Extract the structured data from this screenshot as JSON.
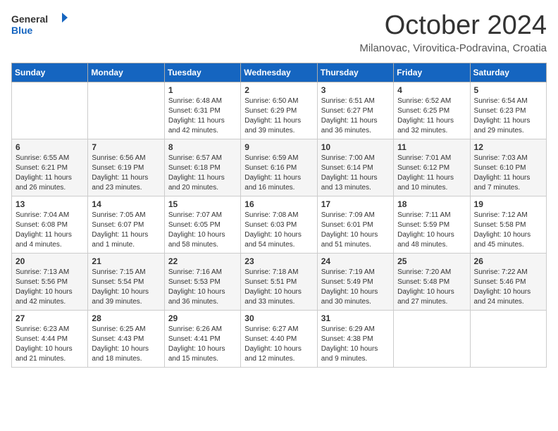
{
  "header": {
    "logo_general": "General",
    "logo_blue": "Blue",
    "month_title": "October 2024",
    "subtitle": "Milanovac, Virovitica-Podravina, Croatia"
  },
  "weekdays": [
    "Sunday",
    "Monday",
    "Tuesday",
    "Wednesday",
    "Thursday",
    "Friday",
    "Saturday"
  ],
  "weeks": [
    [
      {
        "day": "",
        "info": ""
      },
      {
        "day": "",
        "info": ""
      },
      {
        "day": "1",
        "info": "Sunrise: 6:48 AM\nSunset: 6:31 PM\nDaylight: 11 hours and 42 minutes."
      },
      {
        "day": "2",
        "info": "Sunrise: 6:50 AM\nSunset: 6:29 PM\nDaylight: 11 hours and 39 minutes."
      },
      {
        "day": "3",
        "info": "Sunrise: 6:51 AM\nSunset: 6:27 PM\nDaylight: 11 hours and 36 minutes."
      },
      {
        "day": "4",
        "info": "Sunrise: 6:52 AM\nSunset: 6:25 PM\nDaylight: 11 hours and 32 minutes."
      },
      {
        "day": "5",
        "info": "Sunrise: 6:54 AM\nSunset: 6:23 PM\nDaylight: 11 hours and 29 minutes."
      }
    ],
    [
      {
        "day": "6",
        "info": "Sunrise: 6:55 AM\nSunset: 6:21 PM\nDaylight: 11 hours and 26 minutes."
      },
      {
        "day": "7",
        "info": "Sunrise: 6:56 AM\nSunset: 6:19 PM\nDaylight: 11 hours and 23 minutes."
      },
      {
        "day": "8",
        "info": "Sunrise: 6:57 AM\nSunset: 6:18 PM\nDaylight: 11 hours and 20 minutes."
      },
      {
        "day": "9",
        "info": "Sunrise: 6:59 AM\nSunset: 6:16 PM\nDaylight: 11 hours and 16 minutes."
      },
      {
        "day": "10",
        "info": "Sunrise: 7:00 AM\nSunset: 6:14 PM\nDaylight: 11 hours and 13 minutes."
      },
      {
        "day": "11",
        "info": "Sunrise: 7:01 AM\nSunset: 6:12 PM\nDaylight: 11 hours and 10 minutes."
      },
      {
        "day": "12",
        "info": "Sunrise: 7:03 AM\nSunset: 6:10 PM\nDaylight: 11 hours and 7 minutes."
      }
    ],
    [
      {
        "day": "13",
        "info": "Sunrise: 7:04 AM\nSunset: 6:08 PM\nDaylight: 11 hours and 4 minutes."
      },
      {
        "day": "14",
        "info": "Sunrise: 7:05 AM\nSunset: 6:07 PM\nDaylight: 11 hours and 1 minute."
      },
      {
        "day": "15",
        "info": "Sunrise: 7:07 AM\nSunset: 6:05 PM\nDaylight: 10 hours and 58 minutes."
      },
      {
        "day": "16",
        "info": "Sunrise: 7:08 AM\nSunset: 6:03 PM\nDaylight: 10 hours and 54 minutes."
      },
      {
        "day": "17",
        "info": "Sunrise: 7:09 AM\nSunset: 6:01 PM\nDaylight: 10 hours and 51 minutes."
      },
      {
        "day": "18",
        "info": "Sunrise: 7:11 AM\nSunset: 5:59 PM\nDaylight: 10 hours and 48 minutes."
      },
      {
        "day": "19",
        "info": "Sunrise: 7:12 AM\nSunset: 5:58 PM\nDaylight: 10 hours and 45 minutes."
      }
    ],
    [
      {
        "day": "20",
        "info": "Sunrise: 7:13 AM\nSunset: 5:56 PM\nDaylight: 10 hours and 42 minutes."
      },
      {
        "day": "21",
        "info": "Sunrise: 7:15 AM\nSunset: 5:54 PM\nDaylight: 10 hours and 39 minutes."
      },
      {
        "day": "22",
        "info": "Sunrise: 7:16 AM\nSunset: 5:53 PM\nDaylight: 10 hours and 36 minutes."
      },
      {
        "day": "23",
        "info": "Sunrise: 7:18 AM\nSunset: 5:51 PM\nDaylight: 10 hours and 33 minutes."
      },
      {
        "day": "24",
        "info": "Sunrise: 7:19 AM\nSunset: 5:49 PM\nDaylight: 10 hours and 30 minutes."
      },
      {
        "day": "25",
        "info": "Sunrise: 7:20 AM\nSunset: 5:48 PM\nDaylight: 10 hours and 27 minutes."
      },
      {
        "day": "26",
        "info": "Sunrise: 7:22 AM\nSunset: 5:46 PM\nDaylight: 10 hours and 24 minutes."
      }
    ],
    [
      {
        "day": "27",
        "info": "Sunrise: 6:23 AM\nSunset: 4:44 PM\nDaylight: 10 hours and 21 minutes."
      },
      {
        "day": "28",
        "info": "Sunrise: 6:25 AM\nSunset: 4:43 PM\nDaylight: 10 hours and 18 minutes."
      },
      {
        "day": "29",
        "info": "Sunrise: 6:26 AM\nSunset: 4:41 PM\nDaylight: 10 hours and 15 minutes."
      },
      {
        "day": "30",
        "info": "Sunrise: 6:27 AM\nSunset: 4:40 PM\nDaylight: 10 hours and 12 minutes."
      },
      {
        "day": "31",
        "info": "Sunrise: 6:29 AM\nSunset: 4:38 PM\nDaylight: 10 hours and 9 minutes."
      },
      {
        "day": "",
        "info": ""
      },
      {
        "day": "",
        "info": ""
      }
    ]
  ]
}
